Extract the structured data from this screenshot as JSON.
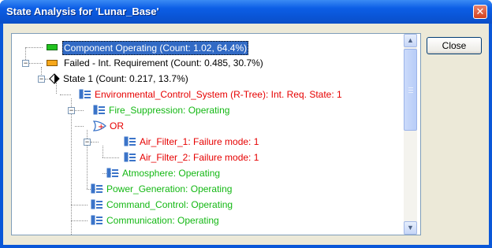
{
  "window": {
    "title": "State Analysis for 'Lunar_Base'",
    "close_glyph": "✕"
  },
  "buttons": {
    "close_label": "Close"
  },
  "colors": {
    "failed": "#e60000",
    "operating": "#14b814",
    "selection": "#316ac5",
    "title_bar": "#0a55d6"
  },
  "tree": {
    "rows": [
      {
        "label": "Component Operating (Count: 1.02, 64.4%)",
        "status": "selected",
        "icon": "green-status-icon"
      },
      {
        "label": "Failed - Int. Requirement (Count: 0.485, 30.7%)",
        "status": "normal",
        "icon": "orange-status-icon"
      },
      {
        "label": "State 1 (Count: 0.217, 13.7%)",
        "status": "normal",
        "icon": "diamond-state-icon"
      },
      {
        "label": "Environmental_Control_System (R-Tree): Int. Req. State: 1",
        "status": "failed",
        "icon": "rbd-block-icon"
      },
      {
        "label": "Fire_Suppression: Operating",
        "status": "operating",
        "icon": "rbd-block-icon"
      },
      {
        "label": "OR",
        "status": "failed",
        "icon": "or-gate-icon"
      },
      {
        "label": "Air_Filter_1: Failure mode: 1",
        "status": "failed",
        "icon": "rbd-block-icon"
      },
      {
        "label": "Air_Filter_2: Failure mode: 1",
        "status": "failed",
        "icon": "rbd-block-icon"
      },
      {
        "label": "Atmosphere: Operating",
        "status": "operating",
        "icon": "rbd-block-icon"
      },
      {
        "label": "Power_Generation: Operating",
        "status": "operating",
        "icon": "rbd-block-icon"
      },
      {
        "label": "Command_Control: Operating",
        "status": "operating",
        "icon": "rbd-block-icon"
      },
      {
        "label": "Communication: Operating",
        "status": "operating",
        "icon": "rbd-block-icon"
      }
    ]
  },
  "scrollbar": {
    "up_icon": "arrow-up-icon",
    "down_icon": "arrow-down-icon",
    "thumb_grip_icon": "grip-icon"
  }
}
